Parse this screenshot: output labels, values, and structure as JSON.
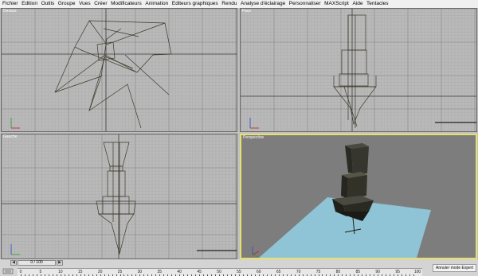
{
  "menubar": {
    "items": [
      "Fichier",
      "Edition",
      "Outils",
      "Groupe",
      "Vues",
      "Créer",
      "Modificateurs",
      "Animation",
      "Editeurs graphiques",
      "Rendu",
      "Analyse d'éclairage",
      "Personnaliser",
      "MAXScript",
      "Aide",
      "Tentacles"
    ]
  },
  "viewports": {
    "top": {
      "label": "Dessus"
    },
    "front": {
      "label": "Face"
    },
    "left": {
      "label": "Gauche"
    },
    "persp": {
      "label": "Perspective"
    }
  },
  "colors": {
    "grid_bg": "#b9b9b9",
    "grid_line": "#a9a9a9",
    "grid_major": "#7f7f7f",
    "wire": "#3c3a2a",
    "active_border": "#e8e06a",
    "floor": "#8fc4d6"
  },
  "status": {
    "frame": "0 / 100",
    "expert_button": "Annuler mode Expert",
    "prev_icon": "chevron-left-icon",
    "next_icon": "chevron-right-icon"
  },
  "timeline": {
    "ticks": [
      "0",
      "5",
      "10",
      "15",
      "20",
      "25",
      "30",
      "35",
      "40",
      "45",
      "50",
      "55",
      "60",
      "65",
      "70",
      "75",
      "80",
      "85",
      "90",
      "95",
      "100"
    ]
  }
}
